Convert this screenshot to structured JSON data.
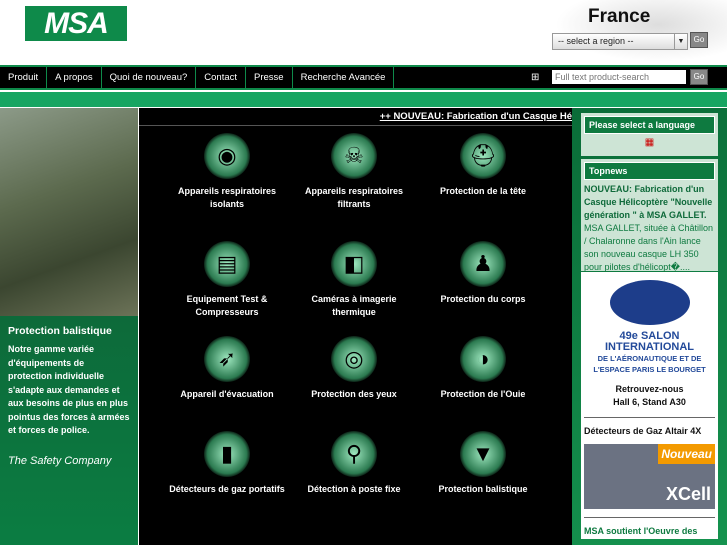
{
  "header": {
    "logo": "MSA",
    "country": "France",
    "region_select": "-- select a region --",
    "go": "Go"
  },
  "nav": {
    "items": [
      "Produit",
      "A propos",
      "Quoi de nouveau?",
      "Contact",
      "Presse",
      "Recherche Avancée"
    ],
    "search_placeholder": "Full text product-search",
    "go": "Go"
  },
  "left": {
    "title": "Protection balistique",
    "text": "Notre gamme variée d'équipements de protection individuelle s'adapte aux demandes et aux besoins de plus en plus pointus des forces à armées et forces de police.",
    "tagline": "The Safety Company"
  },
  "ticker": "++ NOUVEAU: Fabrication d'un Casque Hé",
  "products": [
    {
      "label": "Appareils respiratoires isolants",
      "icon": "scba-icon"
    },
    {
      "label": "Appareils respiratoires filtrants",
      "icon": "gas-mask-icon"
    },
    {
      "label": "Protection de la tête",
      "icon": "helmet-icon"
    },
    {
      "label": "Equipement Test & Compresseurs",
      "icon": "test-equipment-icon"
    },
    {
      "label": "Caméras à imagerie thermique",
      "icon": "thermal-camera-icon"
    },
    {
      "label": "Protection du corps",
      "icon": "body-suit-icon"
    },
    {
      "label": "Appareil d'évacuation",
      "icon": "escape-icon"
    },
    {
      "label": "Protection des yeux",
      "icon": "goggles-icon"
    },
    {
      "label": "Protection de l'Ouie",
      "icon": "earmuff-icon"
    },
    {
      "label": "Détecteurs de gaz portatifs",
      "icon": "portable-detector-icon"
    },
    {
      "label": "Détection à poste fixe",
      "icon": "fixed-detector-icon"
    },
    {
      "label": "Protection balistique",
      "icon": "vest-icon"
    }
  ],
  "right": {
    "lang_title": "Please select a language",
    "topnews_title": "Topnews",
    "news_headline": "NOUVEAU: Fabrication d'un Casque Hélicoptère \"Nouvelle génération \" à MSA GALLET.",
    "news_body": "MSA GALLET, située à Châtillon / Chalaronne dans l'Ain lance son nouveau casque LH 350 pour pilotes d'hélicopt�....",
    "salon_title": "49e SALON INTERNATIONAL",
    "salon_sub": "DE L'AÉRONAUTIQUE ET DE L'ESPACE PARIS LE BOURGET",
    "salon_visit": "Retrouvez-nous",
    "salon_stand": "Hall 6, Stand A30",
    "altair": "Détecteurs de Gaz Altair 4X",
    "nouveau": "Nouveau",
    "xcell": "XCell",
    "oeuvre": "MSA soutient l'Oeuvre des"
  }
}
